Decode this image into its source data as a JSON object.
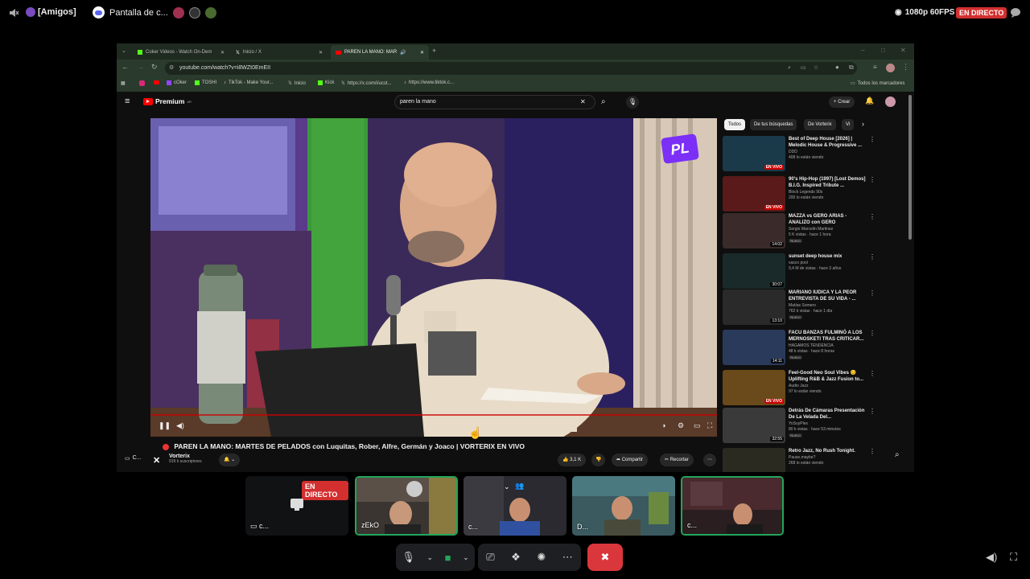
{
  "discord": {
    "server": "[Amigos]",
    "stream_title": "Pantalla de c...",
    "quality": "1080p 60FPS",
    "live": "EN DIRECTO"
  },
  "browser": {
    "tabs": [
      {
        "label": "Coker Videos - Watch On-Dem",
        "icon": "kick-icon"
      },
      {
        "label": "Inicio / X",
        "icon": "x-icon"
      },
      {
        "label": "PAREN LA MANO: MAR",
        "icon": "youtube-icon"
      }
    ],
    "url": "youtube.com/watch?v=i8WZt0EmEII",
    "bookmarks": [
      "cOker",
      "TOSHI",
      "TikTok - Make Your...",
      "Inicio",
      "Kick",
      "https://x.com/i/ucst...",
      "https://www.tiktok.c..."
    ],
    "all_bookmarks": "Todos los marcadores"
  },
  "youtube": {
    "logo": "Premium",
    "logo_super": "AR",
    "search_value": "paren la mano",
    "create_label": "Crear",
    "video_overlay_logo": "PL",
    "video_title": "PAREN LA MANO: MARTES DE PELADOS con Luquitas, Rober, Alfre, Germán y Joaco | VORTERIX EN VIVO",
    "channel_name": "Vorterix",
    "subscribers": "919 k suscriptores",
    "likes": "3,1 K",
    "share_label": "Compartir",
    "clip_label": "Recortar",
    "left_label": "C...",
    "chips": [
      "Todos",
      "De tus búsquedas",
      "De Vorterix",
      "Vi"
    ],
    "recommendations": [
      {
        "title": "Best of Deep House [2026] | Melodic House & Progressive ...",
        "channel": "DDD",
        "meta": "408 lo están viendo",
        "badge": "EN VIVO",
        "nuevo": "",
        "thumb_color": "#1a3a4a"
      },
      {
        "title": "90's Hip-Hop (1997) [Lost Demos] B.I.G. Inspired Tribute ...",
        "channel": "Block Legends 90s",
        "meta": "200 lo están viendo",
        "badge": "EN VIVO",
        "nuevo": "",
        "thumb_color": "#5a1a1a"
      },
      {
        "title": "MAZZA vs GERO ARIAS - ANALIZO con GERO",
        "channel": "Sergio Marcelin Martinez",
        "meta": "5 K vistas · hace 1 hora",
        "badge": "14:02",
        "nuevo": "Nuevo",
        "thumb_color": "#3a2a2a"
      },
      {
        "title": "sunset deep house mix",
        "channel": "vasco pool",
        "meta": "9,4 M de vistas · hace 3 años",
        "badge": "30:07",
        "nuevo": "",
        "thumb_color": "#1a2a2a"
      },
      {
        "title": "MARIANO IUDICA Y LA PEOR ENTREVISTA DE SU VIDA - ...",
        "channel": "Matías Somero",
        "meta": "762 k vistas · hace 1 día",
        "badge": "13:10",
        "nuevo": "Nuevo",
        "thumb_color": "#2a2a2a"
      },
      {
        "title": "FACU BANZAS FULMINÓ A LOS MERNOSKETI TRAS CRITICAR...",
        "channel": "HAGAMOS TENDENCIA",
        "meta": "48 k vistas · hace 8 horas",
        "badge": "14:11",
        "nuevo": "Nuevo",
        "thumb_color": "#2a3a5a"
      },
      {
        "title": "Feel-Good Neo Soul Vibes 😊 Uplifting R&B & Jazz Fusion to...",
        "channel": "Audio Jazz",
        "meta": "97 lo están viendo",
        "badge": "EN VIVO",
        "nuevo": "",
        "thumb_color": "#6a4a1a"
      },
      {
        "title": "Detrás De Cámaras Presentación De La Velada Del...",
        "channel": "YoSoyPlex",
        "meta": "80 k vistas · hace 53 minutos",
        "badge": "32:55",
        "nuevo": "Nuevo",
        "thumb_color": "#3a3a3a"
      },
      {
        "title": "Retro Jazz, No Rush Tonight.",
        "channel": "Pause,maybe?",
        "meta": "268 lo están viendo",
        "badge": "",
        "nuevo": "",
        "thumb_color": "#2a2a20"
      }
    ]
  },
  "participants": {
    "stream_tile_label": "c...",
    "stream_live": "EN DIRECTO",
    "tiles": [
      "zEkO",
      "c...",
      "D...",
      "c..."
    ]
  },
  "colors": {
    "discord_green": "#23a55a",
    "live_red": "#d32f2f",
    "hangup_red": "#da373c",
    "youtube_red": "#ff0000"
  }
}
